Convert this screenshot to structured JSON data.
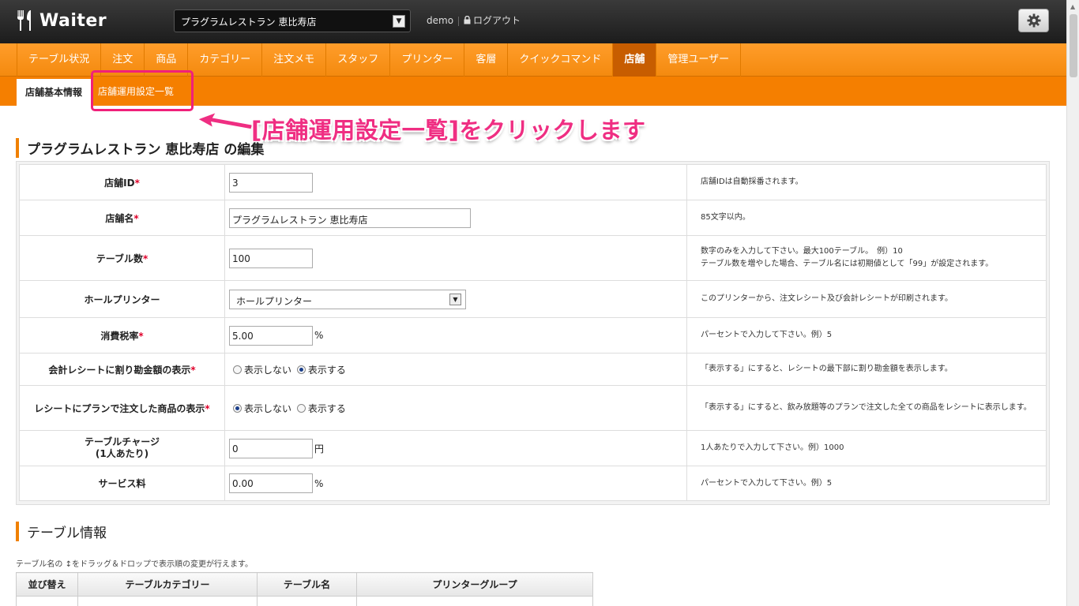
{
  "app": {
    "name": "Waiter"
  },
  "header": {
    "store_select": "プラグラムレストラン 恵比寿店",
    "user": "demo",
    "logout": "ログアウト"
  },
  "main_nav": [
    {
      "label": "テーブル状況"
    },
    {
      "label": "注文"
    },
    {
      "label": "商品"
    },
    {
      "label": "カテゴリー"
    },
    {
      "label": "注文メモ"
    },
    {
      "label": "スタッフ"
    },
    {
      "label": "プリンター"
    },
    {
      "label": "客層"
    },
    {
      "label": "クイックコマンド"
    },
    {
      "label": "店舗",
      "active": true
    },
    {
      "label": "管理ユーザー"
    }
  ],
  "sub_nav": {
    "basic": "店舗基本情報",
    "operation": "店舗運用設定一覧"
  },
  "annotation": "[店舗運用設定一覧]をクリックします",
  "edit_section": {
    "title": "プラグラムレストラン 恵比寿店 の編集"
  },
  "form": {
    "required_mark": "*",
    "rows": {
      "store_id": {
        "label": "店舗ID",
        "value": "3",
        "help": "店舗IDは自動採番されます。"
      },
      "store_name": {
        "label": "店舗名",
        "value": "プラグラムレストラン 恵比寿店",
        "help": "85文字以内。"
      },
      "table_count": {
        "label": "テーブル数",
        "value": "100",
        "help1": "数字のみを入力して下さい。最大100テーブル。　例）10",
        "help2": "テーブル数を増やした場合、テーブル名には初期値として「99」が設定されます。"
      },
      "hall_printer": {
        "label": "ホールプリンター",
        "value": "ホールプリンター",
        "help": "このプリンターから、注文レシート及び会計レシートが印刷されます。"
      },
      "tax_rate": {
        "label": "消費税率",
        "value": "5.00",
        "unit": "%",
        "help": "パーセントで入力して下さい。例）5"
      },
      "split_amount": {
        "label": "会計レシートに割り勘金額の表示",
        "opt_hide": "表示しない",
        "opt_show": "表示する",
        "selected": "表示する",
        "help": "「表示する」にすると、レシートの最下部に割り勘金額を表示します。"
      },
      "plan_items": {
        "label": "レシートにプランで注文した商品の表示",
        "opt_hide": "表示しない",
        "opt_show": "表示する",
        "selected": "表示しない",
        "help": "「表示する」にすると、飲み放題等のプランで注文した全ての商品をレシートに表示します。"
      },
      "table_charge": {
        "label1": "テーブルチャージ",
        "label2": "(1人あたり)",
        "value": "0",
        "unit": "円",
        "help": "1人あたりで入力して下さい。例）1000"
      },
      "service_fee": {
        "label": "サービス料",
        "value": "0.00",
        "unit": "%",
        "help": "パーセントで入力して下さい。例）5"
      }
    }
  },
  "table_section": {
    "title": "テーブル情報",
    "note": "テーブル名の ↕をドラッグ＆ドロップで表示順の変更が行えます。",
    "headers": [
      "並び替え",
      "テーブルカテゴリー",
      "テーブル名",
      "プリンターグループ"
    ]
  },
  "colors": {
    "accent": "#f57f00",
    "highlight": "#ef2e82",
    "topbar": "#2a2a2a"
  }
}
